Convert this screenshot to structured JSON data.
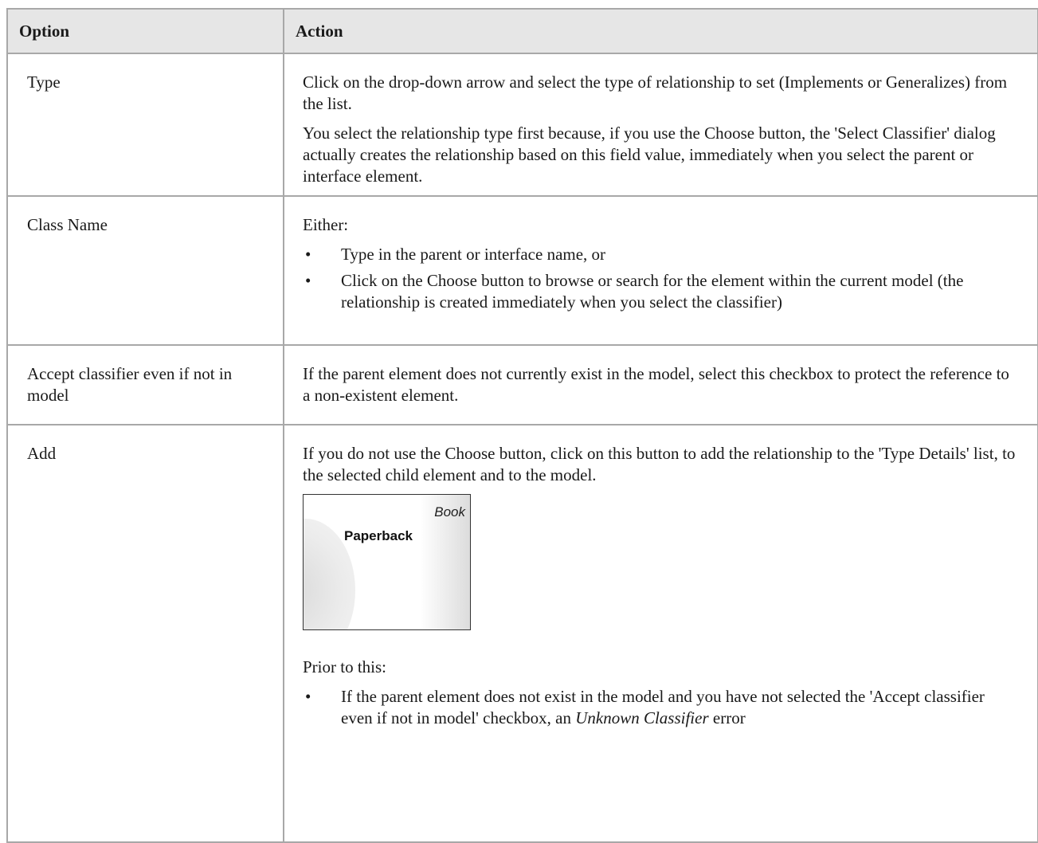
{
  "table": {
    "headers": [
      "Option",
      "Action"
    ],
    "rows": {
      "type": {
        "option": "Type",
        "action_p1": "Click on the drop-down arrow and select the type of relationship to set (Implements or Generalizes) from the list.",
        "action_p2": "You select the relationship type first because, if you use the Choose button, the 'Select Classifier' dialog actually creates the relationship based on this field value, immediately when you select the parent or interface element."
      },
      "class_name": {
        "option": "Class Name",
        "intro": "Either:",
        "bullets": [
          "Type in the parent or interface name, or",
          "Click on the Choose button to browse or search for the element within the current model (the relationship is created immediately when you select the classifier)"
        ]
      },
      "accept": {
        "option": "Accept classifier even if not in model",
        "action": "If the parent element does not currently exist in the model, select this checkbox to protect the reference to a non-existent element."
      },
      "add": {
        "option": "Add",
        "action_p1": "If you do not use the Choose button, click on this button to add the relationship to the 'Type Details' list, to the selected child element and to the model.",
        "figure": {
          "stereotype": "Book",
          "element_name": "Paperback"
        },
        "prior": "Prior to this:",
        "bullet_pre": "If the parent element does not exist in the model and you have not selected the 'Accept classifier even if not in model' checkbox, an ",
        "bullet_em": "Unknown Classifier",
        "bullet_post": " error"
      }
    }
  },
  "bullet_glyph": "•"
}
